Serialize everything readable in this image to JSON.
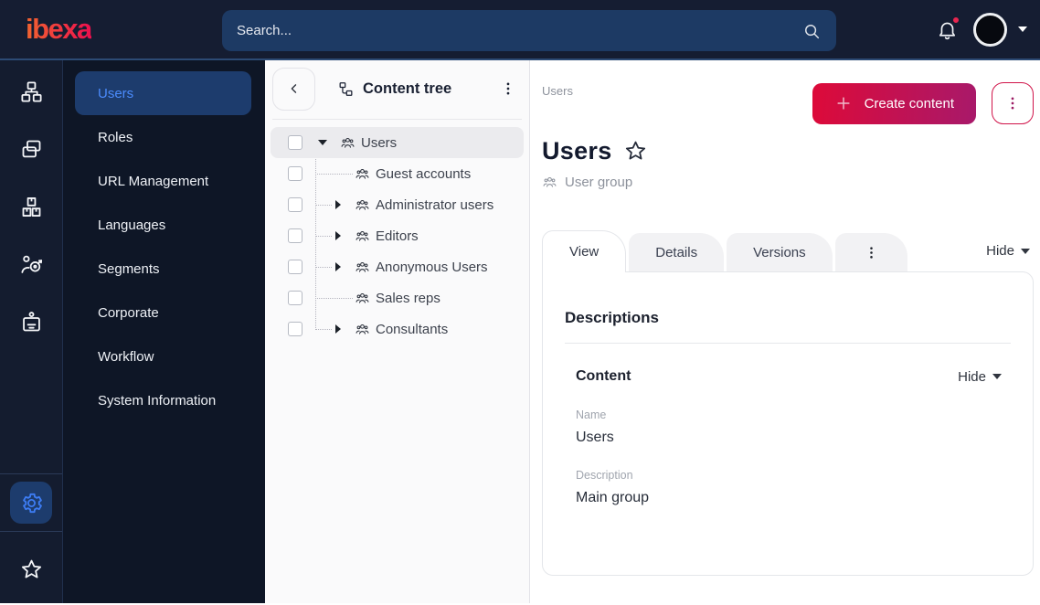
{
  "topbar": {
    "logo_text": "ibexa",
    "search_placeholder": "Search...",
    "has_notification": true
  },
  "rail_icons": [
    "content-structure",
    "pages",
    "product-catalog",
    "customers",
    "corporate",
    "admin-settings",
    "bookmarks"
  ],
  "sidebar": {
    "items": [
      {
        "label": "Users",
        "active": true
      },
      {
        "label": "Roles",
        "active": false
      },
      {
        "label": "URL Management",
        "active": false
      },
      {
        "label": "Languages",
        "active": false
      },
      {
        "label": "Segments",
        "active": false
      },
      {
        "label": "Corporate",
        "active": false
      },
      {
        "label": "Workflow",
        "active": false
      },
      {
        "label": "System Information",
        "active": false
      }
    ]
  },
  "content_tree": {
    "title": "Content tree",
    "items": [
      {
        "label": "Users",
        "state": "expanded",
        "selected": true
      },
      {
        "label": "Guest accounts",
        "state": "leaf",
        "selected": false
      },
      {
        "label": "Administrator users",
        "state": "collapsed",
        "selected": false
      },
      {
        "label": "Editors",
        "state": "collapsed",
        "selected": false
      },
      {
        "label": "Anonymous Users",
        "state": "collapsed",
        "selected": false
      },
      {
        "label": "Sales reps",
        "state": "leaf",
        "selected": false
      },
      {
        "label": "Consultants",
        "state": "collapsed",
        "selected": false
      }
    ]
  },
  "main": {
    "breadcrumb": "Users",
    "create_button_label": "Create content",
    "page_title": "Users",
    "content_type_label": "User group",
    "tabs": [
      {
        "label": "View",
        "active": true
      },
      {
        "label": "Details",
        "active": false
      },
      {
        "label": "Versions",
        "active": false
      }
    ],
    "collapse_label": "Hide",
    "view_panel": {
      "section_title": "Descriptions",
      "group_title": "Content",
      "group_collapse_label": "Hide",
      "fields": [
        {
          "label": "Name",
          "value": "Users"
        },
        {
          "label": "Description",
          "value": "Main group"
        }
      ]
    }
  },
  "colors": {
    "topbar_bg": "#151d32",
    "sidebar_bg": "#0e1626",
    "accent_line": "#2c4a74",
    "search_bg": "#1d3a64",
    "selected_nav_bg": "#1d3c6d",
    "selected_nav_text": "#4b8bfc",
    "active_icon_blue": "#3d7df5",
    "primary_gradient_start": "#dd0a39",
    "primary_gradient_end": "#a8196a",
    "notification_badge": "#e8254f"
  }
}
